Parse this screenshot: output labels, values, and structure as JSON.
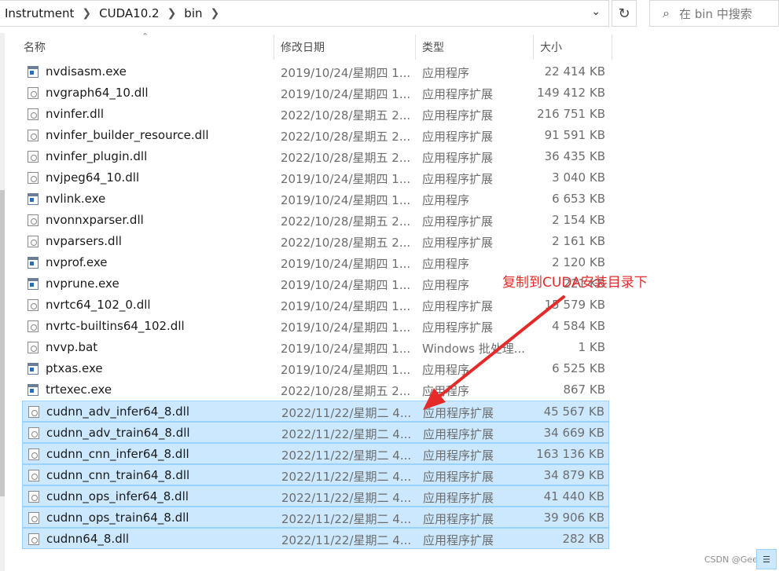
{
  "address_bar": {
    "crumbs": [
      "Instrutment",
      "CUDA10.2",
      "bin"
    ]
  },
  "search": {
    "placeholder": "在 bin 中搜索"
  },
  "columns": {
    "name": "名称",
    "modified": "修改日期",
    "type": "类型",
    "size": "大小"
  },
  "files": [
    {
      "name": "nvdisasm.exe",
      "date": "2019/10/24/星期四 1...",
      "type": "应用程序",
      "size": "22 414 KB",
      "icon": "exe",
      "selected": false
    },
    {
      "name": "nvgraph64_10.dll",
      "date": "2019/10/24/星期四 1...",
      "type": "应用程序扩展",
      "size": "149 412 KB",
      "icon": "dll",
      "selected": false
    },
    {
      "name": "nvinfer.dll",
      "date": "2022/10/28/星期五 2...",
      "type": "应用程序扩展",
      "size": "216 751 KB",
      "icon": "dll",
      "selected": false
    },
    {
      "name": "nvinfer_builder_resource.dll",
      "date": "2022/10/28/星期五 2...",
      "type": "应用程序扩展",
      "size": "91 591 KB",
      "icon": "dll",
      "selected": false
    },
    {
      "name": "nvinfer_plugin.dll",
      "date": "2022/10/28/星期五 2...",
      "type": "应用程序扩展",
      "size": "36 435 KB",
      "icon": "dll",
      "selected": false
    },
    {
      "name": "nvjpeg64_10.dll",
      "date": "2019/10/24/星期四 1...",
      "type": "应用程序扩展",
      "size": "3 040 KB",
      "icon": "dll",
      "selected": false
    },
    {
      "name": "nvlink.exe",
      "date": "2019/10/24/星期四 1...",
      "type": "应用程序",
      "size": "6 653 KB",
      "icon": "exe",
      "selected": false
    },
    {
      "name": "nvonnxparser.dll",
      "date": "2022/10/28/星期五 2...",
      "type": "应用程序扩展",
      "size": "2 154 KB",
      "icon": "dll",
      "selected": false
    },
    {
      "name": "nvparsers.dll",
      "date": "2022/10/28/星期五 2...",
      "type": "应用程序扩展",
      "size": "2 161 KB",
      "icon": "dll",
      "selected": false
    },
    {
      "name": "nvprof.exe",
      "date": "2019/10/24/星期四 1...",
      "type": "应用程序",
      "size": "2 120 KB",
      "icon": "exe",
      "selected": false
    },
    {
      "name": "nvprune.exe",
      "date": "2019/10/24/星期四 1...",
      "type": "应用程序",
      "size": "221 KB",
      "icon": "exe",
      "selected": false
    },
    {
      "name": "nvrtc64_102_0.dll",
      "date": "2019/10/24/星期四 1...",
      "type": "应用程序扩展",
      "size": "15 579 KB",
      "icon": "dll",
      "selected": false
    },
    {
      "name": "nvrtc-builtins64_102.dll",
      "date": "2019/10/24/星期四 1...",
      "type": "应用程序扩展",
      "size": "4 584 KB",
      "icon": "dll",
      "selected": false
    },
    {
      "name": "nvvp.bat",
      "date": "2019/10/24/星期四 1...",
      "type": "Windows 批处理...",
      "size": "1 KB",
      "icon": "bat",
      "selected": false
    },
    {
      "name": "ptxas.exe",
      "date": "2019/10/24/星期四 1...",
      "type": "应用程序",
      "size": "6 525 KB",
      "icon": "exe",
      "selected": false
    },
    {
      "name": "trtexec.exe",
      "date": "2022/10/28/星期五 2...",
      "type": "应用程序",
      "size": "867 KB",
      "icon": "exe",
      "selected": false
    },
    {
      "name": "cudnn_adv_infer64_8.dll",
      "date": "2022/11/22/星期二 4...",
      "type": "应用程序扩展",
      "size": "45 567 KB",
      "icon": "dll",
      "selected": true
    },
    {
      "name": "cudnn_adv_train64_8.dll",
      "date": "2022/11/22/星期二 4...",
      "type": "应用程序扩展",
      "size": "34 669 KB",
      "icon": "dll",
      "selected": true
    },
    {
      "name": "cudnn_cnn_infer64_8.dll",
      "date": "2022/11/22/星期二 4...",
      "type": "应用程序扩展",
      "size": "163 136 KB",
      "icon": "dll",
      "selected": true
    },
    {
      "name": "cudnn_cnn_train64_8.dll",
      "date": "2022/11/22/星期二 4...",
      "type": "应用程序扩展",
      "size": "34 879 KB",
      "icon": "dll",
      "selected": true
    },
    {
      "name": "cudnn_ops_infer64_8.dll",
      "date": "2022/11/22/星期二 4...",
      "type": "应用程序扩展",
      "size": "41 440 KB",
      "icon": "dll",
      "selected": true
    },
    {
      "name": "cudnn_ops_train64_8.dll",
      "date": "2022/11/22/星期二 4...",
      "type": "应用程序扩展",
      "size": "39 906 KB",
      "icon": "dll",
      "selected": true
    },
    {
      "name": "cudnn64_8.dll",
      "date": "2022/11/22/星期二 4...",
      "type": "应用程序扩展",
      "size": "282 KB",
      "icon": "dll",
      "selected": true
    }
  ],
  "annotation": {
    "text": "复制到CUDA安装目录下",
    "color": "#e52a2a"
  },
  "watermark": "CSDN @Geek",
  "colors": {
    "selection_bg": "#cce8ff",
    "selection_border": "#99d1ff"
  }
}
